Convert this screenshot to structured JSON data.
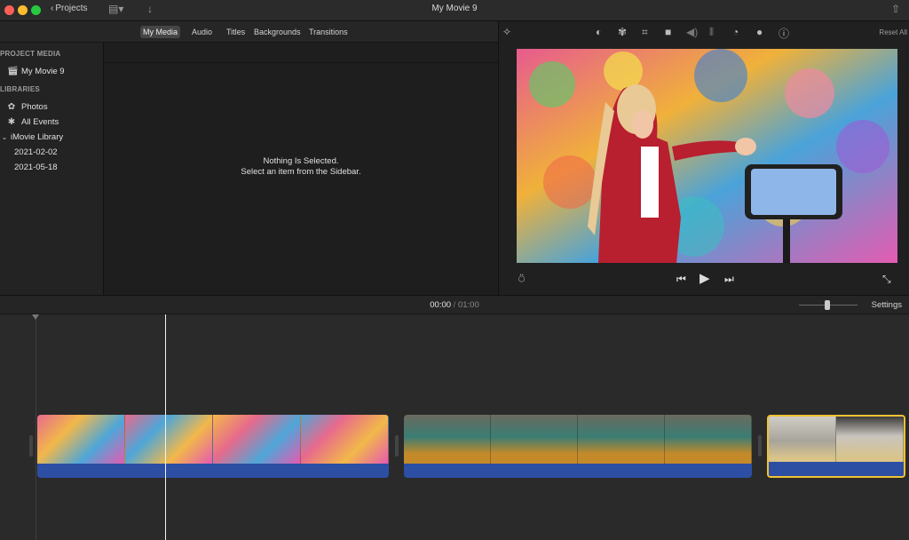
{
  "window": {
    "title": "My Movie 9",
    "back_label": "Projects"
  },
  "browser_tabs": [
    "My Media",
    "Audio",
    "Titles",
    "Backgrounds",
    "Transitions"
  ],
  "active_tab": "My Media",
  "sidebar": {
    "project_media_header": "PROJECT MEDIA",
    "project_item": "My Movie 9",
    "libraries_header": "LIBRARIES",
    "items": [
      {
        "label": "Photos",
        "icon": "photos-icon"
      },
      {
        "label": "All Events",
        "icon": "star-icon"
      },
      {
        "label": "iMovie Library",
        "icon": "disclosure-icon"
      },
      {
        "label": "2021-02-02",
        "icon": ""
      },
      {
        "label": "2021-05-18",
        "icon": ""
      }
    ]
  },
  "browser": {
    "empty_line1": "Nothing Is Selected.",
    "empty_line2": "Select an item from the Sidebar."
  },
  "viewer": {
    "reset_label": "Reset All"
  },
  "timeline": {
    "current_time": "00:00",
    "separator": "/",
    "total_time": "01:00",
    "settings_label": "Settings"
  },
  "colors": {
    "accent_selection": "#f1c232",
    "audio_track": "#2c4ea3"
  }
}
